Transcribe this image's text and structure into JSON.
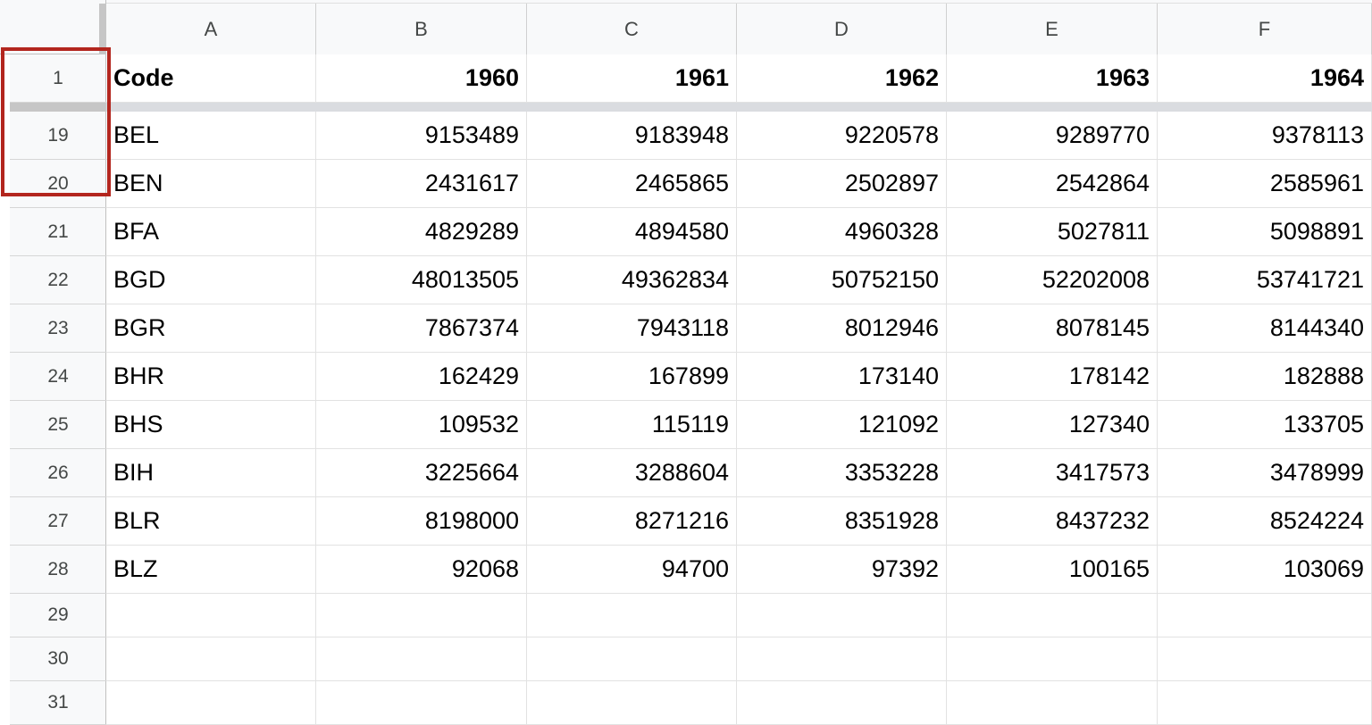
{
  "columns": [
    "A",
    "B",
    "C",
    "D",
    "E",
    "F"
  ],
  "header_row": {
    "row_number": "1",
    "cells": [
      "Code",
      "1960",
      "1961",
      "1962",
      "1963",
      "1964"
    ]
  },
  "rows": [
    {
      "row_number": "19",
      "cells": [
        "BEL",
        "9153489",
        "9183948",
        "9220578",
        "9289770",
        "9378113"
      ]
    },
    {
      "row_number": "20",
      "cells": [
        "BEN",
        "2431617",
        "2465865",
        "2502897",
        "2542864",
        "2585961"
      ]
    },
    {
      "row_number": "21",
      "cells": [
        "BFA",
        "4829289",
        "4894580",
        "4960328",
        "5027811",
        "5098891"
      ]
    },
    {
      "row_number": "22",
      "cells": [
        "BGD",
        "48013505",
        "49362834",
        "50752150",
        "52202008",
        "53741721"
      ]
    },
    {
      "row_number": "23",
      "cells": [
        "BGR",
        "7867374",
        "7943118",
        "8012946",
        "8078145",
        "8144340"
      ]
    },
    {
      "row_number": "24",
      "cells": [
        "BHR",
        "162429",
        "167899",
        "173140",
        "178142",
        "182888"
      ]
    },
    {
      "row_number": "25",
      "cells": [
        "BHS",
        "109532",
        "115119",
        "121092",
        "127340",
        "133705"
      ]
    },
    {
      "row_number": "26",
      "cells": [
        "BIH",
        "3225664",
        "3288604",
        "3353228",
        "3417573",
        "3478999"
      ]
    },
    {
      "row_number": "27",
      "cells": [
        "BLR",
        "8198000",
        "8271216",
        "8351928",
        "8437232",
        "8524224"
      ]
    },
    {
      "row_number": "28",
      "cells": [
        "BLZ",
        "92068",
        "94700",
        "97392",
        "100165",
        "103069"
      ]
    }
  ],
  "empty_rows": [
    "29",
    "30",
    "31"
  ],
  "colors": {
    "highlight": "#b3261e",
    "header_bg": "#f8f9fa",
    "freeze_bar": "#dadce0"
  }
}
